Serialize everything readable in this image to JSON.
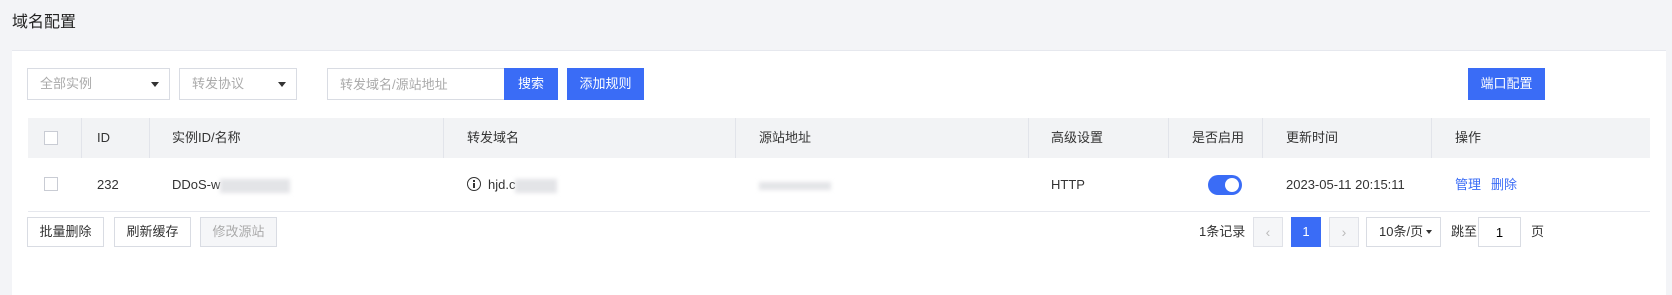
{
  "page": {
    "title": "域名配置"
  },
  "toolbar": {
    "instance_select": "全部实例",
    "protocol_select": "转发协议",
    "search_placeholder": "转发域名/源站地址",
    "search_label": "搜索",
    "add_rule_label": "添加规则",
    "port_config_label": "端口配置"
  },
  "table": {
    "headers": {
      "id": "ID",
      "instance": "实例ID/名称",
      "domain": "转发域名",
      "origin": "源站地址",
      "advanced": "高级设置",
      "enabled": "是否启用",
      "updated": "更新时间",
      "actions": "操作"
    },
    "rows": [
      {
        "id": "232",
        "instance": "DDoS-w",
        "domain": "hjd.c",
        "origin": "",
        "advanced": "HTTP",
        "enabled": true,
        "updated": "2023-05-11 20:15:11",
        "action_manage": "管理",
        "action_delete": "删除"
      }
    ]
  },
  "footer": {
    "batch_delete": "批量删除",
    "refresh_cache": "刷新缓存",
    "modify_origin": "修改源站",
    "record_count": "1条记录",
    "prev_icon": "‹",
    "current_page": "1",
    "next_icon": "›",
    "page_size": "10条/页",
    "jump_label": "跳至",
    "jump_value": "1",
    "page_unit": "页"
  },
  "colors": {
    "primary": "#3a6cf6",
    "background": "#f3f4f7",
    "header_bg": "#f2f3f5"
  }
}
